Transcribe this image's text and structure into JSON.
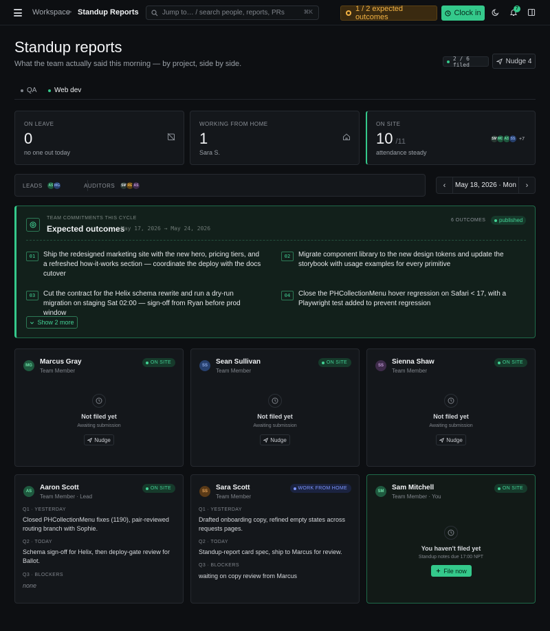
{
  "topbar": {
    "crumb_workspace": "Workspace",
    "crumb_sep": ">",
    "crumb_current": "Standup Reports",
    "search_placeholder": "Jump to… / search people, reports, PRs",
    "search_kbd": "⌘K",
    "outcomes_pill": "1 / 2 expected outcomes",
    "clockin_label": "Clock in",
    "bell_count": "7"
  },
  "header": {
    "title": "Standup reports",
    "subtitle": "What the team actually said this morning — by project, side by side.",
    "filed": "2 / 6 filed",
    "nudge_all": "Nudge 4"
  },
  "tabs": [
    {
      "label": "QA",
      "active": false
    },
    {
      "label": "Web dev",
      "active": true
    }
  ],
  "stats": {
    "leave": {
      "label": "ON LEAVE",
      "value": "0",
      "sub": "no one out today"
    },
    "wfh": {
      "label": "WORKING FROM HOME",
      "value": "1",
      "sub": "Sara S."
    },
    "onsite": {
      "label": "ON SITE",
      "value": "10",
      "total": "/11",
      "sub": "attendance steady",
      "more": "+7",
      "avatars": [
        "SM",
        "MG",
        "AS",
        "SS"
      ]
    }
  },
  "leads": {
    "leads_label": "LEADS",
    "leads": [
      "AS",
      "MG"
    ],
    "auditors_label": "AUDITORS",
    "auditors": [
      "SM",
      "RE",
      "AS"
    ]
  },
  "date": {
    "label": "May 18, 2026 · Mon",
    "prev": "‹",
    "next": "›"
  },
  "outcomes": {
    "kicker": "TEAM COMMITMENTS THIS CYCLE",
    "title": "Expected outcomes",
    "range": "May 17, 2026 → May 24, 2026",
    "count": "6 OUTCOMES",
    "status": "published",
    "items": [
      {
        "code": "01",
        "text": "Ship the redesigned marketing site with the new hero, pricing tiers, and a refreshed how-it-works section — coordinate the deploy with the docs cutover"
      },
      {
        "code": "02",
        "text": "Migrate component library to the new design tokens and update the storybook with usage examples for every primitive"
      },
      {
        "code": "03",
        "text": "Cut the contract for the Helix schema rewrite and run a dry-run migration on staging Sat 02:00 — sign-off from Ryan before prod window"
      },
      {
        "code": "04",
        "text": "Close the PHCollectionMenu hover regression on Safari < 17, with a Playwright test added to prevent regression"
      }
    ],
    "show_more": "Show 2 more"
  },
  "members": [
    {
      "initials": "MG",
      "name": "Marcus Gray",
      "role": "Team Member",
      "status": "ON SITE",
      "empty_title": "Not filed yet",
      "empty_sub": "Awaiting submission",
      "action": "Nudge",
      "color": "#1f5a3f",
      "fg": "#6ee0a8"
    },
    {
      "initials": "SS",
      "name": "Sean Sullivan",
      "role": "Team Member",
      "status": "ON SITE",
      "empty_title": "Not filed yet",
      "empty_sub": "Awaiting submission",
      "action": "Nudge",
      "color": "#27406e",
      "fg": "#8aa8e8"
    },
    {
      "initials": "SS",
      "name": "Sienna Shaw",
      "role": "Team Member",
      "status": "ON SITE",
      "empty_title": "Not filed yet",
      "empty_sub": "Awaiting submission",
      "action": "Nudge",
      "color": "#3e2b4a",
      "fg": "#c39bd8"
    },
    {
      "initials": "AS",
      "name": "Aaron Scott",
      "role": "Team Member · Lead",
      "status": "ON SITE",
      "color": "#1f5a3f",
      "fg": "#6ee0a8",
      "qa": [
        {
          "q": "Q1 · YESTERDAY",
          "a": "Closed PHCollectionMenu fixes (1190), pair-reviewed routing branch with Sophie."
        },
        {
          "q": "Q2 · TODAY",
          "a": "Schema sign-off for Helix, then deploy-gate review for Ballot."
        },
        {
          "q": "Q3 · BLOCKERS",
          "a": "none"
        }
      ]
    },
    {
      "initials": "SS",
      "name": "Sara Scott",
      "role": "Team Member",
      "status": "WORK FROM HOME",
      "color": "#5a3a17",
      "fg": "#e8a55a",
      "qa": [
        {
          "q": "Q1 · YESTERDAY",
          "a": "Drafted onboarding copy, refined empty states across requests pages."
        },
        {
          "q": "Q2 · TODAY",
          "a": "Standup-report card spec, ship to Marcus for review."
        },
        {
          "q": "Q3 · BLOCKERS",
          "a": "waiting on copy review from Marcus"
        }
      ]
    },
    {
      "initials": "SM",
      "name": "Sam Mitchell",
      "role": "Team Member · You",
      "status": "ON SITE",
      "empty_title": "You haven't filed yet",
      "empty_sub": "Standup notes due 17:00 NPT",
      "action": "File now",
      "color": "#1f5a3f",
      "fg": "#6ee0a8"
    }
  ]
}
